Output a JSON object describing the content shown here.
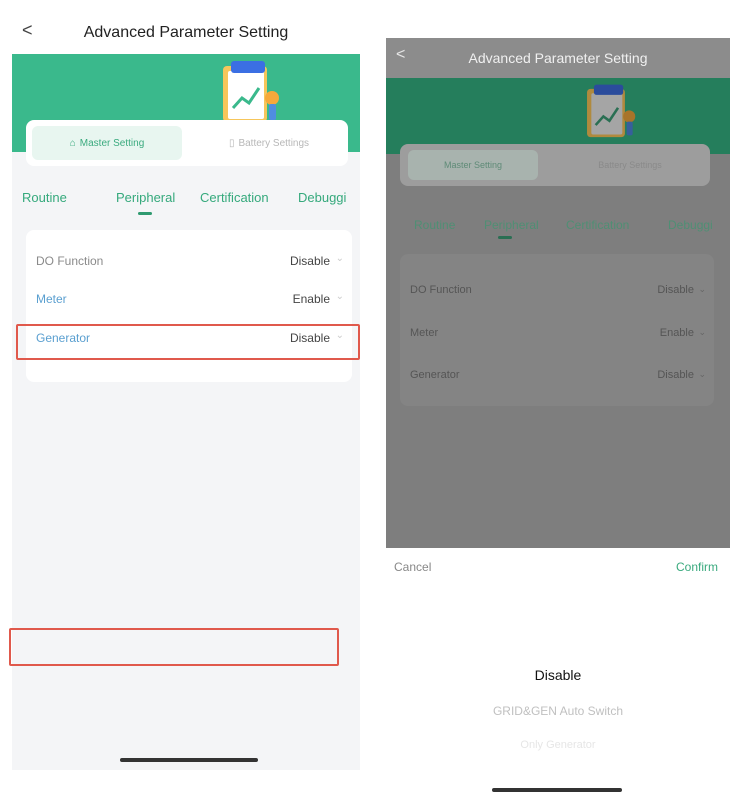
{
  "header": {
    "back_glyph": "<",
    "title": "Advanced Parameter Setting"
  },
  "mode_switch": {
    "master_label": "Master Setting",
    "battery_label": "Battery Settings"
  },
  "tabs": [
    {
      "label": "Routine"
    },
    {
      "label": "Peripheral"
    },
    {
      "label": "Certification"
    },
    {
      "label": "Debuggi"
    }
  ],
  "settings": [
    {
      "label": "DO Function",
      "value": "Disable",
      "label_color": "#8a8a8a"
    },
    {
      "label": "Meter",
      "value": "Enable",
      "label_color": "#5a9fd0"
    },
    {
      "label": "Generator",
      "value": "Disable",
      "label_color": "#5a9fd0"
    }
  ],
  "picker": {
    "cancel_label": "Cancel",
    "confirm_label": "Confirm",
    "options": [
      "Disable",
      "GRID&GEN Auto Switch",
      "Only Generator"
    ]
  },
  "colors": {
    "accent": "#3ab98c",
    "highlight": "#e0594c"
  },
  "icons": {
    "chevron": "chevron-down-icon",
    "back": "back-arrow-icon"
  }
}
